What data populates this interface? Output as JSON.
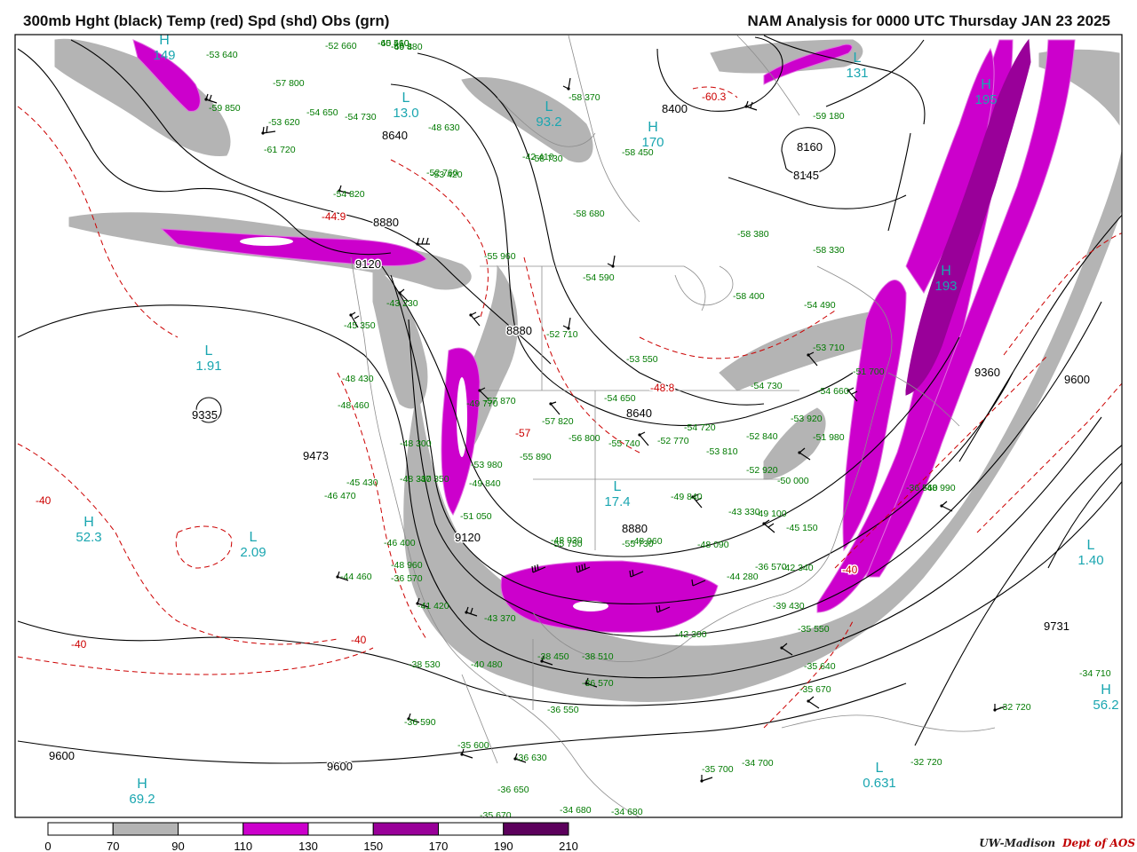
{
  "title_left": "300mb Hght (black) Temp (red) Spd (shd) Obs (grn)",
  "title_right": "NAM Analysis for 0000 UTC Thursday  JAN 23 2025",
  "credit": {
    "org": "UW-Madison",
    "dept": "Dept of AOS"
  },
  "colors": {
    "shade70": "#b4b4b4",
    "shade110": "#cc00cc",
    "shade150": "#990099",
    "shade190": "#5c005c",
    "obs": "#007a00",
    "temp": "#cc0000",
    "height": "#000000",
    "centers": "#1aa6b0"
  },
  "colorbar": {
    "ticks": [
      "0",
      "70",
      "90",
      "110",
      "130",
      "150",
      "170",
      "190",
      "210"
    ],
    "bins": [
      {
        "range": "0-70",
        "color": "#ffffff"
      },
      {
        "range": "70-90",
        "color": "#b4b4b4"
      },
      {
        "range": "90-110",
        "color": "#ffffff"
      },
      {
        "range": "110-130",
        "color": "#cc00cc"
      },
      {
        "range": "130-150",
        "color": "#ffffff"
      },
      {
        "range": "150-170",
        "color": "#990099"
      },
      {
        "range": "170-190",
        "color": "#ffffff"
      },
      {
        "range": "190-210",
        "color": "#5c005c"
      }
    ]
  },
  "contour_labels": [
    "8640",
    "8400",
    "8160",
    "8145",
    "8880",
    "9120",
    "9360",
    "9600",
    "8880",
    "9120",
    "9473",
    "9335",
    "8640",
    "8880",
    "9731",
    "9600",
    "9600"
  ],
  "temp_labels": [
    "-44.9",
    "-48.8",
    "-57",
    "-60.3",
    "-40",
    "-40",
    "-40",
    "-40"
  ],
  "centers": [
    {
      "letter": "L",
      "value": "13.0"
    },
    {
      "letter": "L",
      "value": "93.2"
    },
    {
      "letter": "H",
      "value": "170"
    },
    {
      "letter": "L",
      "value": "131"
    },
    {
      "letter": "H",
      "value": "195"
    },
    {
      "letter": "L",
      "value": "1.91"
    },
    {
      "letter": "H",
      "value": "52.3"
    },
    {
      "letter": "L",
      "value": "2.09"
    },
    {
      "letter": "L",
      "value": "17.4"
    },
    {
      "letter": "L",
      "value": "1.40"
    },
    {
      "letter": "H",
      "value": "56.2"
    },
    {
      "letter": "H",
      "value": "69.2"
    },
    {
      "letter": "L",
      "value": "0.631"
    },
    {
      "letter": "H",
      "value": "149"
    },
    {
      "letter": "H",
      "value": "193"
    }
  ],
  "obs": [
    [
      "-60",
      "510"
    ],
    [
      "-60",
      "4"
    ],
    [
      "-58",
      "370"
    ],
    [
      "-58",
      "450"
    ],
    [
      "-58",
      "730"
    ],
    [
      "-58",
      "680"
    ],
    [
      "-54",
      "590"
    ],
    [
      "-58",
      "380"
    ],
    [
      "-58",
      "330"
    ],
    [
      "-58",
      "400"
    ],
    [
      "-59",
      "180"
    ],
    [
      "-54",
      "490"
    ],
    [
      "-53",
      "710"
    ],
    [
      "-51",
      "700"
    ],
    [
      "-54",
      "730"
    ],
    [
      "-54",
      "660"
    ],
    [
      "-53",
      "920"
    ],
    [
      "-52",
      "840"
    ],
    [
      "-51",
      "980"
    ],
    [
      "-52",
      "920"
    ],
    [
      "-50",
      "000"
    ],
    [
      "-49",
      "100"
    ],
    [
      "-45",
      "150"
    ],
    [
      "-42",
      "340"
    ],
    [
      "-39",
      "430"
    ],
    [
      "-35",
      "550"
    ],
    [
      "-35",
      "640"
    ],
    [
      "-35",
      "670"
    ],
    [
      "-34",
      "710"
    ],
    [
      "-32",
      "720"
    ],
    [
      "-32",
      "720"
    ],
    [
      "-34",
      "700"
    ],
    [
      "-35",
      "700"
    ],
    [
      "-34",
      "680"
    ],
    [
      "-34",
      "680"
    ],
    [
      "-35",
      "670"
    ],
    [
      "-36",
      "650"
    ],
    [
      "-36",
      "630"
    ],
    [
      "-35",
      "600"
    ],
    [
      "-36",
      "590"
    ],
    [
      "-36",
      "550"
    ],
    [
      "-36",
      "570"
    ],
    [
      "-38",
      "510"
    ],
    [
      "-38",
      "450"
    ],
    [
      "-38",
      "530"
    ],
    [
      "-40",
      "480"
    ],
    [
      "-43",
      "370"
    ],
    [
      "-41",
      "420"
    ],
    [
      "-44",
      "460"
    ],
    [
      "-46",
      "470"
    ],
    [
      "-45",
      "430"
    ],
    [
      "-48",
      "460"
    ],
    [
      "-48",
      "430"
    ],
    [
      "-46",
      "400"
    ],
    [
      "-45",
      "350"
    ],
    [
      "-43",
      "230"
    ],
    [
      "-48",
      "300"
    ],
    [
      "-48",
      "330"
    ],
    [
      "-47",
      "350"
    ],
    [
      "-51",
      "050"
    ],
    [
      "-53",
      "980"
    ],
    [
      "-55",
      "890"
    ],
    [
      "-56",
      "800"
    ],
    [
      "-57",
      "820"
    ],
    [
      "-55",
      "740"
    ],
    [
      "-52",
      "770"
    ],
    [
      "-54",
      "720"
    ],
    [
      "-53",
      "810"
    ],
    [
      "-49",
      "840"
    ],
    [
      "-48",
      "930"
    ],
    [
      "-48",
      "960"
    ],
    [
      "-48",
      "090"
    ],
    [
      "-44",
      "280"
    ],
    [
      "-54",
      "650"
    ],
    [
      "-53",
      "550"
    ],
    [
      "-52",
      "710"
    ],
    [
      "-55",
      "960"
    ],
    [
      "-52",
      "760"
    ],
    [
      "-54",
      "820"
    ],
    [
      "-57",
      "800"
    ],
    [
      "-53",
      "640"
    ],
    [
      "-52",
      "660"
    ],
    [
      "-54",
      "730"
    ],
    [
      "-54",
      "650"
    ],
    [
      "-61",
      "720"
    ],
    [
      "-59",
      "850"
    ],
    [
      "-53",
      "620"
    ],
    [
      "-48",
      "630"
    ],
    [
      "-49",
      "840"
    ],
    [
      "-49",
      "770"
    ],
    [
      "-57",
      "870"
    ],
    [
      "-48",
      "990"
    ],
    [
      "-36",
      "560"
    ],
    [
      "-36",
      "570"
    ],
    [
      "-42",
      "300"
    ],
    [
      "-42",
      "410"
    ],
    [
      "-53",
      "420"
    ],
    [
      "-55",
      "730"
    ],
    [
      "-55",
      "750"
    ],
    [
      "-48",
      "960"
    ],
    [
      "-36",
      "570"
    ],
    [
      "-43",
      "330"
    ],
    [
      "-45",
      "460"
    ],
    [
      "-49",
      "880"
    ]
  ]
}
